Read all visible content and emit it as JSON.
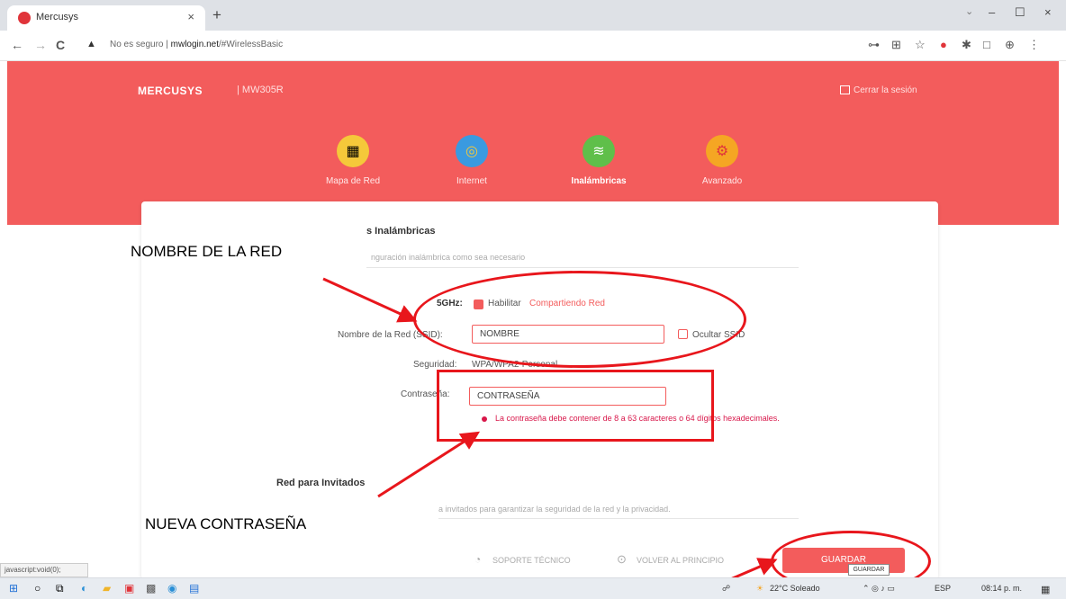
{
  "browser": {
    "tab_title": "Mercusys",
    "tab_close": "×",
    "new_tab": "+",
    "win_minimize": "–",
    "win_maximize": "☐",
    "win_close": "×",
    "back": "←",
    "forward": "→",
    "reload": "C",
    "security_label": "No es seguro",
    "url_host": "mwlogin.net",
    "url_path": "/#WirelessBasic"
  },
  "router": {
    "logo": "MERCUSYS",
    "model": "| MW305R",
    "logout": "Cerrar la sesión",
    "nav": [
      {
        "label": "Mapa de Red",
        "color": "#f5c83a"
      },
      {
        "label": "Internet",
        "color": "#3a9ae0"
      },
      {
        "label": "Inalámbricas",
        "color": "#5fbf4a"
      },
      {
        "label": "Avanzado",
        "color": "#f5a623"
      }
    ]
  },
  "wireless": {
    "section_title": "s Inalámbricas",
    "section_desc": "nguración inalámbrica como sea necesario",
    "band_label": "5GHz:",
    "enable_label": "Habilitar",
    "share_network": "Compartiendo Red",
    "ssid_label": "Nombre de la Red (SSID):",
    "ssid_value": "NOMBRE",
    "hide_ssid": "Ocultar SSID",
    "security_label": "Seguridad:",
    "security_value": "WPA/WPA2-Personal",
    "password_label": "Contraseña:",
    "password_value": "CONTRASEÑA",
    "password_hint": "La contraseña debe contener de 8 a 63 caracteres o 64 dígitos hexadecimales.",
    "guest_title": "Red para Invitados",
    "guest_desc": "a invitados para garantizar la seguridad de la red y la privacidad."
  },
  "footer": {
    "support": "SOPORTE TÉCNICO",
    "back_home": "VOLVER AL PRINCIPIO",
    "save": "GUARDAR",
    "tooltip": "GUARDAR"
  },
  "statusbar": {
    "link": "javascript:void(0);"
  },
  "annotations": {
    "network_name": "NOMBRE DE LA RED",
    "new_password": "NUEVA CONTRASEÑA",
    "color": "#e8161c"
  },
  "taskbar": {
    "weather": "22°C  Soleado",
    "lang": "ESP",
    "time": "08:14 p. m."
  }
}
